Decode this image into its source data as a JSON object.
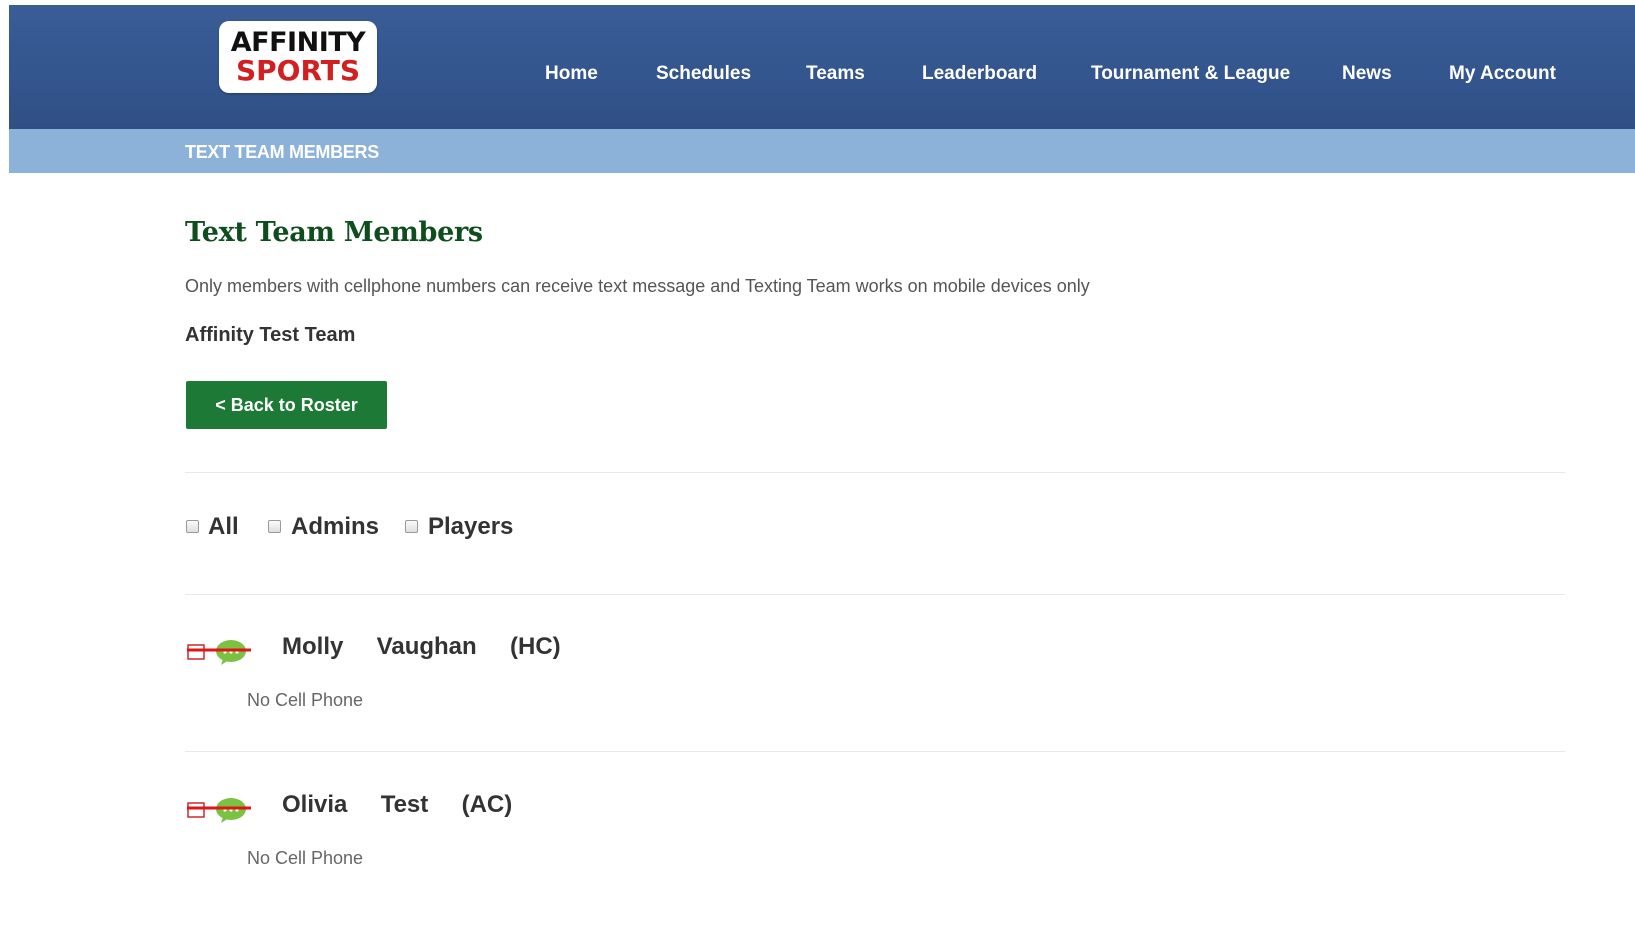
{
  "header": {
    "logo_line1": "AFFINITY",
    "logo_line2": "SPORTS",
    "nav": [
      {
        "label": "Home"
      },
      {
        "label": "Schedules"
      },
      {
        "label": "Teams"
      },
      {
        "label": "Leaderboard"
      },
      {
        "label": "Tournament & League"
      },
      {
        "label": "News"
      },
      {
        "label": "My Account"
      }
    ]
  },
  "breadcrumb": "TEXT TEAM MEMBERS",
  "main": {
    "title": "Text Team Members",
    "notice": "Only members with cellphone numbers can receive text message and Texting Team works on mobile devices only",
    "team_name": "Affinity Test Team",
    "back_button": "< Back to Roster"
  },
  "filters": [
    {
      "label": "All",
      "checked": false
    },
    {
      "label": "Admins",
      "checked": false
    },
    {
      "label": "Players",
      "checked": false
    }
  ],
  "members": [
    {
      "name": "Molly  Vaughan  (HC)",
      "phone": "No Cell Phone",
      "icon": "no-text-message-icon"
    },
    {
      "name": "Olivia  Test  (AC)",
      "phone": "No Cell Phone",
      "icon": "no-text-message-icon"
    }
  ],
  "colors": {
    "header_bg": "#34568f",
    "breadcrumb_bg": "#8cb2d9",
    "title_green": "#0f4d1f",
    "button_green": "#1c7a36",
    "logo_red": "#d21f1f",
    "strike_red": "#e01515",
    "bubble_green": "#7cc242"
  }
}
